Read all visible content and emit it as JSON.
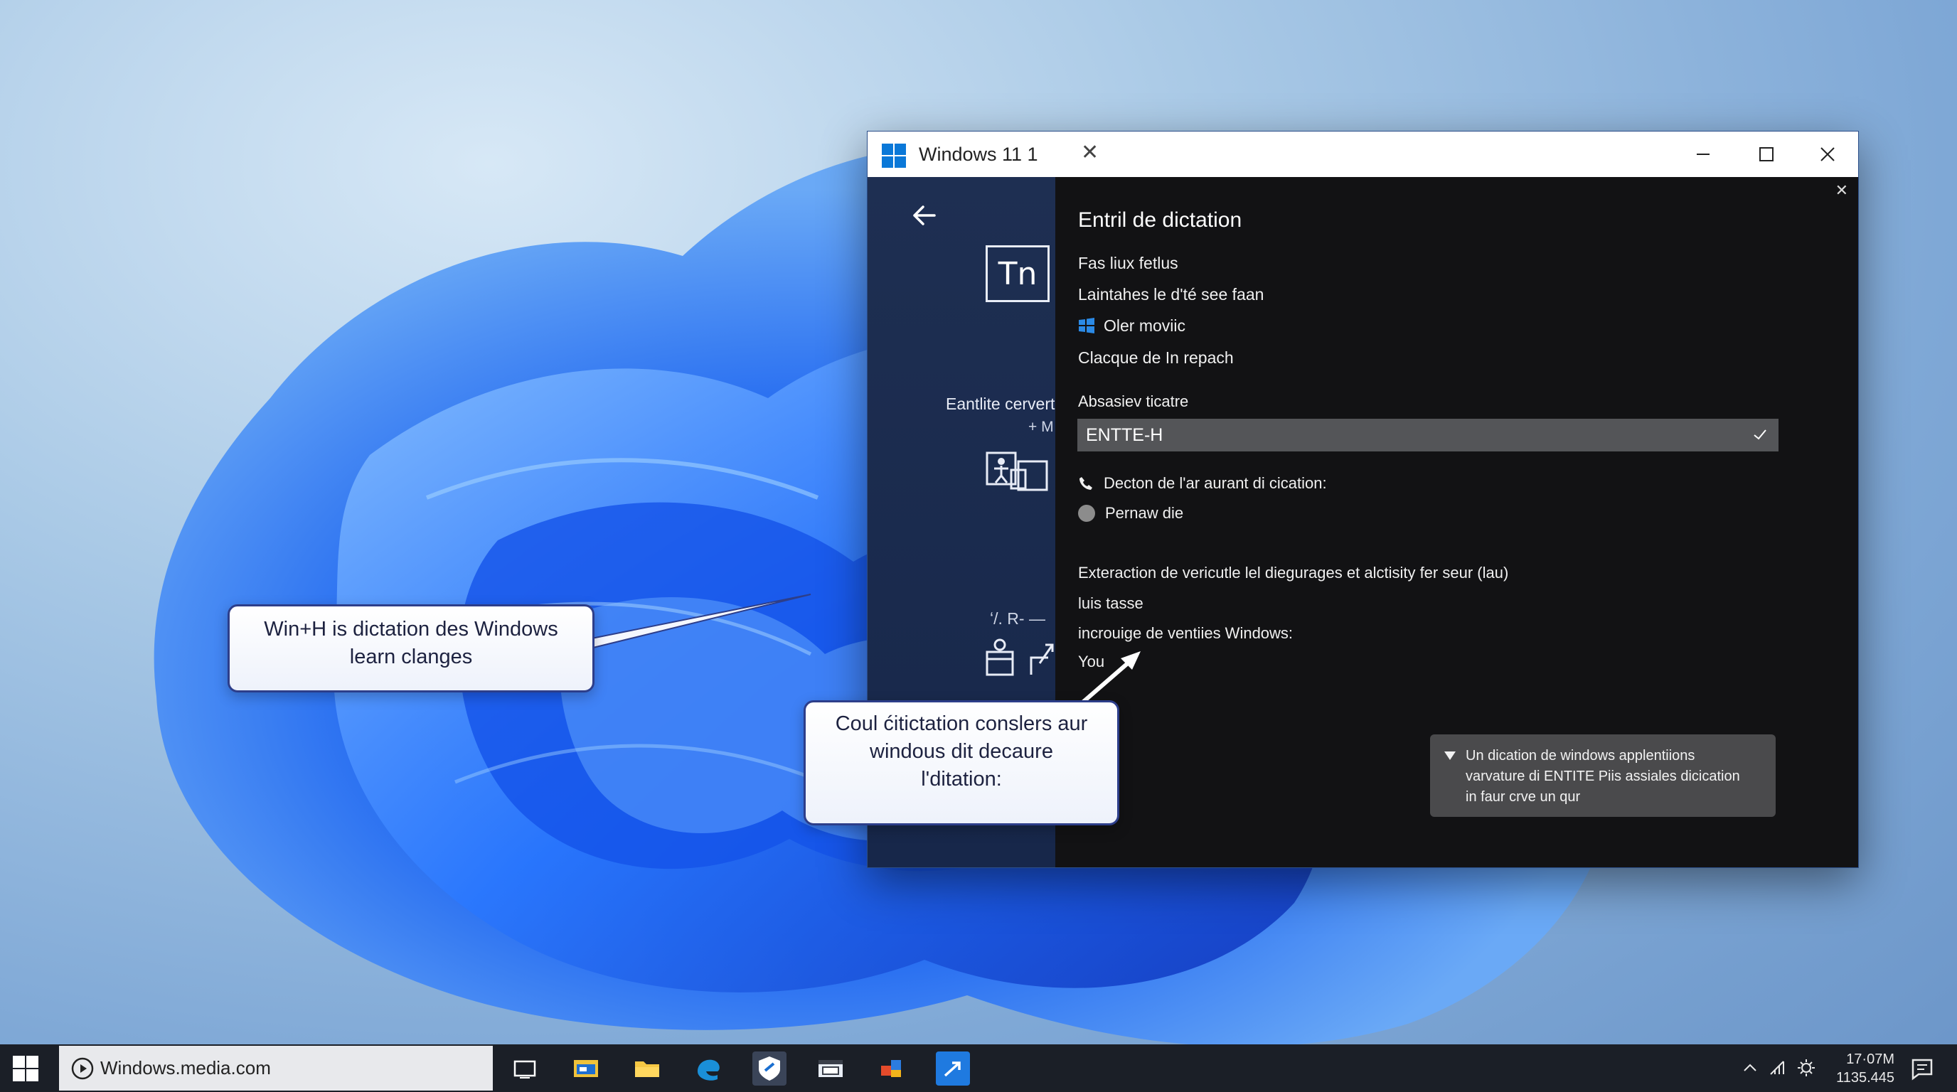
{
  "window": {
    "title": "Windows 11 1",
    "tab_close": "✕"
  },
  "left_pane": {
    "app_glyph": "Tn",
    "label": "Eantlite cervert",
    "plus_text": "+ M",
    "small_text": "ʻ/. R- —"
  },
  "right_pane": {
    "close": "✕",
    "heading": "Entril de dictation",
    "items": [
      "Fas liux fetlus",
      "Laintahes le d'té see faan",
      "Oler moviic",
      "Clacque de In repach"
    ],
    "combo_label": "Absasiev ticatre",
    "combo_value": "ENTTE-H",
    "phone_line": "Decton de l'ar aurant di cication:",
    "radio_line": "Pernaw die",
    "extra_line": "Exteraction de vericutle lel diegurages et alctisity fer seur (lau)",
    "line_tasse": "luis tasse",
    "line_windows": "incrouige de ventiies Windows:",
    "line_you": "You",
    "info_box": [
      "Un dication de windows applentiions",
      "varvature di ENTITE Piis assiales dicication",
      "in faur crve un qur"
    ]
  },
  "callouts": {
    "one": [
      "Win+H is dictation des Windows",
      "learn clanges"
    ],
    "two": [
      "Coul ćitictation conslers aur",
      "windous dit decaure",
      "l'ditation:"
    ]
  },
  "taskbar": {
    "search_text": "Windows.media.com",
    "clock_time": "17·07M",
    "clock_date": "1135.445"
  },
  "colors": {
    "accent": "#0078d4",
    "window_bg": "#121214",
    "left_pane": "#1e2f52",
    "taskbar": "#1b1f27"
  }
}
